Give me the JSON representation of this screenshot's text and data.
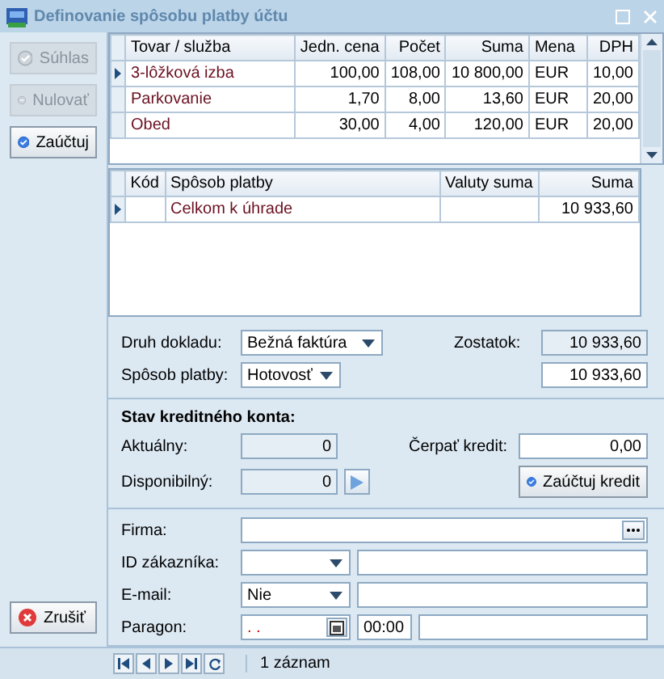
{
  "window": {
    "title": "Definovanie spôsobu platby účtu"
  },
  "side_buttons": [
    {
      "label": "Súhlas",
      "kind": "approve",
      "disabled": true
    },
    {
      "label": "Nulovať",
      "kind": "reset",
      "disabled": true
    },
    {
      "label": "Zaúčtuj",
      "kind": "post",
      "disabled": false
    }
  ],
  "cancel_button": {
    "label": "Zrušiť"
  },
  "items_table": {
    "columns": [
      "Tovar / služba",
      "Jedn. cena",
      "Počet",
      "Suma",
      "Mena",
      "DPH"
    ],
    "rows": [
      {
        "selected": true,
        "cells": [
          "3-lôžková izba",
          "100,00",
          "108,00",
          "10 800,00",
          "EUR",
          "10,00"
        ]
      },
      {
        "selected": false,
        "cells": [
          "Parkovanie",
          "1,70",
          "8,00",
          "13,60",
          "EUR",
          "20,00"
        ]
      },
      {
        "selected": false,
        "cells": [
          "Obed",
          "30,00",
          "4,00",
          "120,00",
          "EUR",
          "20,00"
        ]
      }
    ]
  },
  "payments_table": {
    "columns": [
      "Kód",
      "Spôsob platby",
      "Valuty suma",
      "Suma"
    ],
    "rows": [
      {
        "selected": true,
        "cells": [
          "",
          "Celkom k úhrade",
          "",
          "10 933,60"
        ]
      }
    ]
  },
  "document": {
    "type_label": "Druh dokladu:",
    "type_value": "Bežná faktúra",
    "method_label": "Spôsob platby:",
    "method_value": "Hotovosť",
    "balance_label": "Zostatok:",
    "balance_value": "10 933,60",
    "amount_value": "10 933,60"
  },
  "credit": {
    "title": "Stav kreditného konta:",
    "current_label": "Aktuálny:",
    "current_value": "0",
    "available_label": "Disponibilný:",
    "available_value": "0",
    "draw_label": "Čerpať kredit:",
    "draw_value": "0,00",
    "post_button": "Zaúčtuj kredit"
  },
  "customer": {
    "firm_label": "Firma:",
    "id_label": "ID zákazníka:",
    "email_label": "E-mail:",
    "email_value": "Nie",
    "receipt_label": "Paragon:",
    "receipt_date": ". .",
    "receipt_time": "00:00"
  },
  "status_bar": {
    "records": "1 záznam"
  }
}
